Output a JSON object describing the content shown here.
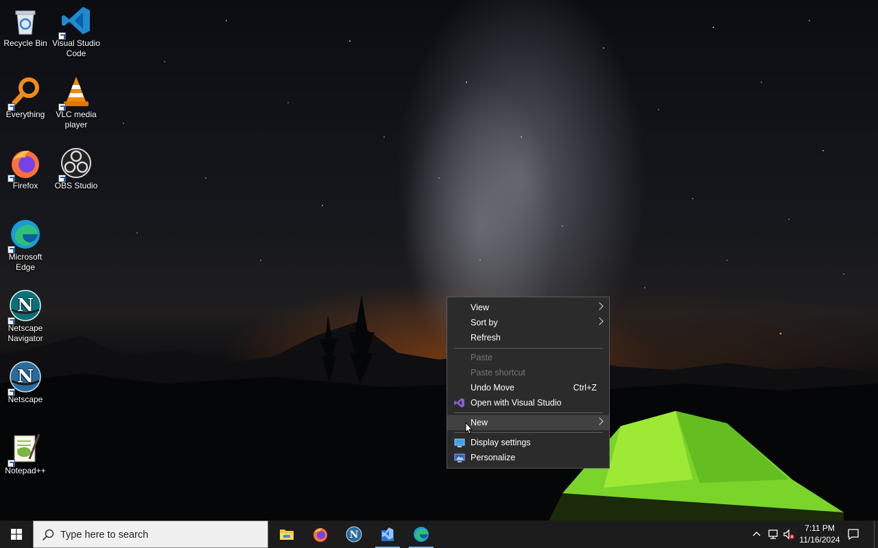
{
  "desktop_icons": [
    {
      "id": "recycle-bin",
      "label1": "Recycle Bin",
      "label2": ""
    },
    {
      "id": "vscode",
      "label1": "Visual Studio",
      "label2": "Code"
    },
    {
      "id": "everything",
      "label1": "Everything",
      "label2": ""
    },
    {
      "id": "vlc",
      "label1": "VLC media",
      "label2": "player"
    },
    {
      "id": "firefox",
      "label1": "Firefox",
      "label2": ""
    },
    {
      "id": "obs",
      "label1": "OBS Studio",
      "label2": ""
    },
    {
      "id": "edge",
      "label1": "Microsoft",
      "label2": "Edge"
    },
    {
      "id": "netscape-navigator",
      "label1": "Netscape",
      "label2": "Navigator"
    },
    {
      "id": "netscape",
      "label1": "Netscape",
      "label2": ""
    },
    {
      "id": "notepadpp",
      "label1": "Notepad++",
      "label2": ""
    }
  ],
  "context_menu": {
    "items": [
      {
        "label": "View",
        "submenu": true
      },
      {
        "label": "Sort by",
        "submenu": true
      },
      {
        "label": "Refresh"
      },
      {
        "label": "Paste",
        "disabled": true
      },
      {
        "label": "Paste shortcut",
        "disabled": true
      },
      {
        "label": "Undo Move",
        "shortcut": "Ctrl+Z"
      },
      {
        "label": "Open with Visual Studio",
        "icon": "visual-studio-icon"
      },
      {
        "label": "New",
        "submenu": true,
        "highlighted": true
      },
      {
        "label": "Display settings",
        "icon": "display-settings-icon"
      },
      {
        "label": "Personalize",
        "icon": "personalize-icon"
      }
    ]
  },
  "taskbar": {
    "search_placeholder": "Type here to search",
    "pinned_apps": [
      "file-explorer",
      "firefox",
      "netscape",
      "visual-studio-installer",
      "edge"
    ],
    "active_apps": [
      "visual-studio-installer",
      "edge"
    ],
    "clock": {
      "time": "7:11 PM",
      "date": "11/16/2024"
    },
    "colors": {
      "taskbar": "#1c1c1c",
      "menu": "#2b2b2b",
      "accent": "#76b9ed"
    }
  }
}
